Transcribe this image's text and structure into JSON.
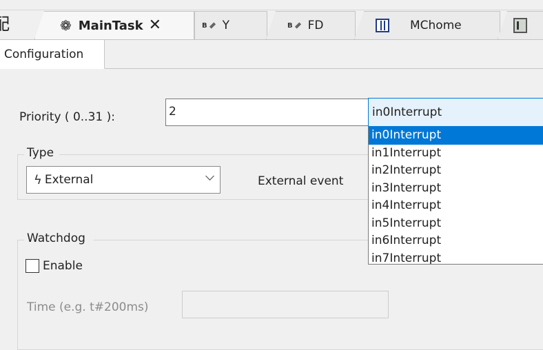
{
  "tabs": {
    "items": [
      {
        "label": "MainTask"
      },
      {
        "label": "Y"
      },
      {
        "label": "FD"
      },
      {
        "label": "MChome"
      }
    ]
  },
  "subtab": {
    "label": "Configuration"
  },
  "priority": {
    "label": "Priority ( 0..31 ):",
    "value": "2"
  },
  "type_group": {
    "title": "Type",
    "selected": "External",
    "event_label": "External event",
    "event_value": "in0Interrupt",
    "options": [
      "in0Interrupt",
      "in1Interrupt",
      "in2Interrupt",
      "in3Interrupt",
      "in4Interrupt",
      "in5Interrupt",
      "in6Interrupt",
      "in7Interrupt"
    ]
  },
  "watchdog": {
    "title": "Watchdog",
    "enable_label": "Enable",
    "time_label": "Time (e.g. t#200ms)"
  }
}
